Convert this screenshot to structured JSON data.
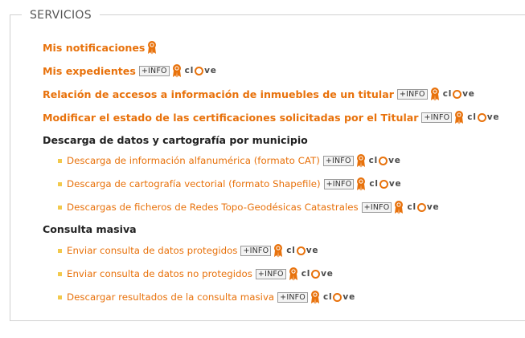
{
  "section": {
    "legend": "SERVICIOS"
  },
  "main_links": [
    {
      "label": "Mis notificaciones",
      "info": "",
      "clave": false
    },
    {
      "label": "Mis expedientes",
      "info": "+INFO",
      "clave": true
    },
    {
      "label": "Relación de accesos a información de inmuebles de un titular",
      "info": "+INFO",
      "clave": true
    },
    {
      "label": "Modificar el estado de las certificaciones solicitadas por el Titular",
      "info": "+INFO",
      "clave": true
    }
  ],
  "groups": [
    {
      "heading": "Descarga de datos y cartografía por municipio",
      "items": [
        {
          "label": "Descarga de información alfanumérica (formato CAT)",
          "info": "+INFO"
        },
        {
          "label": "Descarga de cartografía vectorial (formato Shapefile)",
          "info": "+INFO"
        },
        {
          "label": "Descargas de ficheros de Redes Topo-Geodésicas Catastrales",
          "info": "+INFO"
        }
      ]
    },
    {
      "heading": "Consulta masiva",
      "items": [
        {
          "label": "Enviar consulta de datos protegidos",
          "info": "+INFO"
        },
        {
          "label": "Enviar consulta de datos no protegidos",
          "info": "+INFO"
        },
        {
          "label": "Descargar resultados de la consulta masiva",
          "info": "+INFO"
        }
      ]
    }
  ],
  "clave_logo": {
    "pre": "cl",
    "post": "ve",
    "icon": "clave-logo",
    "accent": "#e8720c"
  },
  "icons": {
    "certificate": "certificate-ribbon-icon"
  },
  "colors": {
    "link": "#e8720c",
    "heading": "#222222",
    "bullet": "#f2c94c",
    "border": "#d0d0d0"
  }
}
